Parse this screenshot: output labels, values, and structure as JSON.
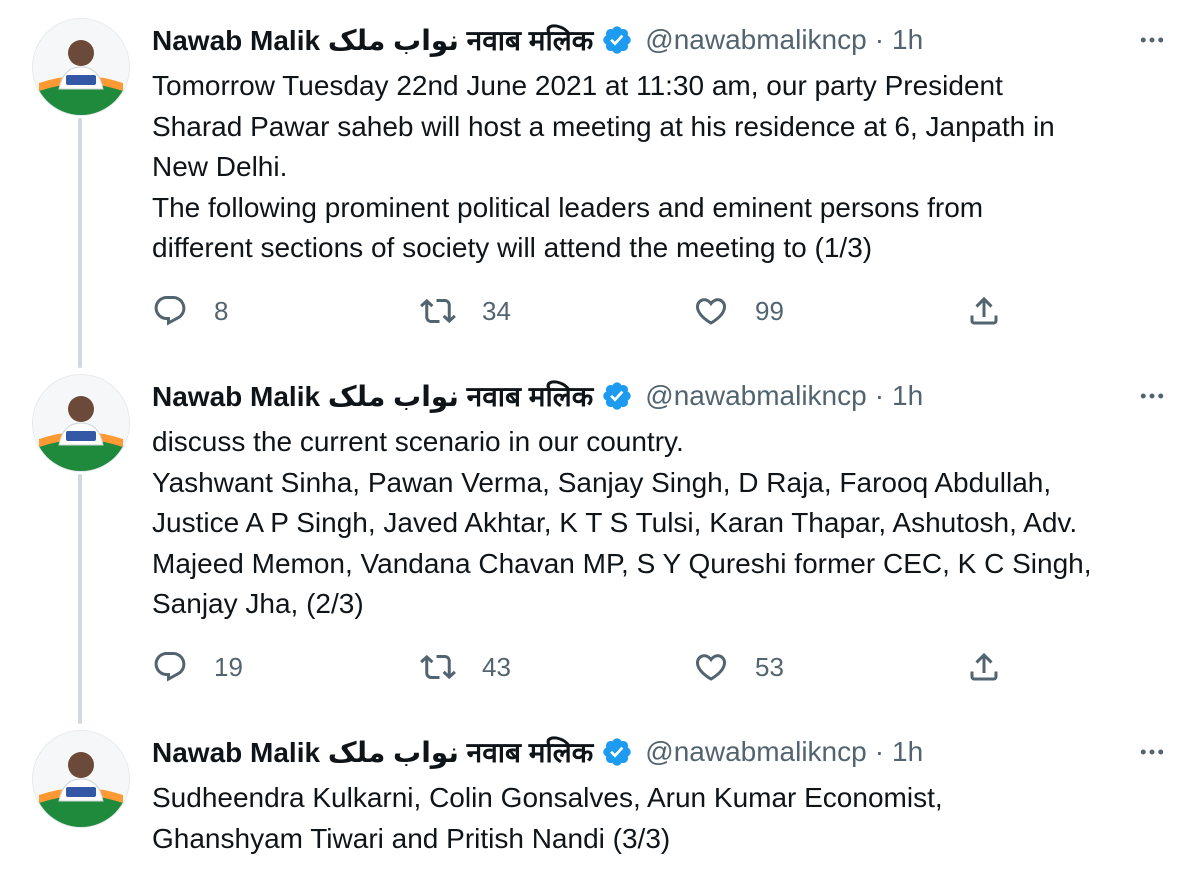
{
  "thread": [
    {
      "author": {
        "name": "Nawab Malik نواب ملک नवाब मलिक",
        "handle": "@nawabmalikncp",
        "verified": true,
        "avatar_icon": "profile-photo-avatar"
      },
      "time": "1h",
      "lines": [
        "Tomorrow Tuesday 22nd June 2021 at 11:30 am, our party President",
        "Sharad Pawar saheb will host a meeting at his residence at 6, Janpath in",
        "New Delhi.",
        "The following prominent political leaders and eminent persons from",
        "different sections of society will attend the meeting to (1/3)"
      ],
      "stats": {
        "replies": "8",
        "retweets": "34",
        "likes": "99"
      }
    },
    {
      "author": {
        "name": "Nawab Malik نواب ملک नवाब मलिक",
        "handle": "@nawabmalikncp",
        "verified": true,
        "avatar_icon": "profile-photo-avatar"
      },
      "time": "1h",
      "lines": [
        "discuss the current scenario in our country.",
        "Yashwant Sinha, Pawan Verma, Sanjay Singh, D Raja, Farooq Abdullah,",
        "Justice A P Singh, Javed Akhtar, K T S Tulsi, Karan Thapar, Ashutosh, Adv.",
        "Majeed Memon, Vandana Chavan MP, S Y Qureshi former CEC, K C Singh,",
        "Sanjay Jha, (2/3)"
      ],
      "stats": {
        "replies": "19",
        "retweets": "43",
        "likes": "53"
      }
    },
    {
      "author": {
        "name": "Nawab Malik نواب ملک नवाब मलिक",
        "handle": "@nawabmalikncp",
        "verified": true,
        "avatar_icon": "profile-photo-avatar"
      },
      "time": "1h",
      "lines": [
        "Sudheendra Kulkarni, Colin Gonsalves, Arun Kumar Economist,",
        "Ghanshyam Tiwari and Pritish Nandi (3/3)"
      ]
    }
  ],
  "ui": {
    "separator": "·",
    "icons": [
      "reply-icon",
      "retweet-icon",
      "like-icon",
      "share-icon",
      "more-icon",
      "verified-badge-icon"
    ]
  },
  "colors": {
    "accent": "#1d9bf0",
    "secondary_text": "#536471",
    "thread_line": "#cfd9de",
    "primary_text": "#0f1419"
  }
}
